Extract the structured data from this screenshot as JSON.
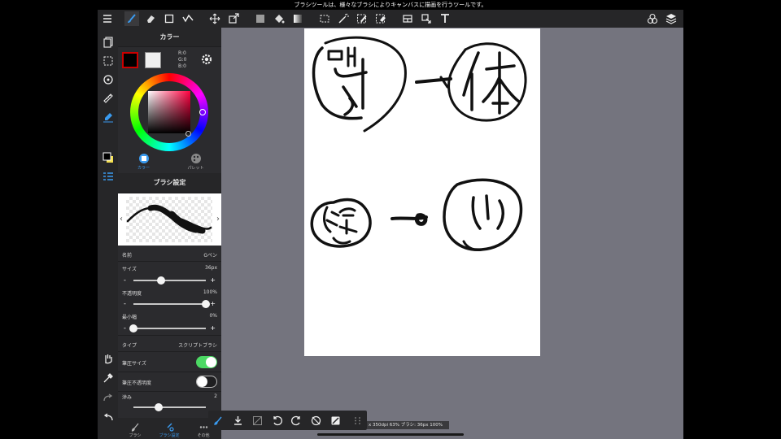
{
  "tooltip": "ブラシツールは、様々なブラシによりキャンバスに描画を行うツールです。",
  "toolbar": {
    "icons": [
      "menu-icon",
      "brush-icon",
      "eraser-icon",
      "shape-icon",
      "correction-pen-icon",
      "move-icon",
      "transform-icon",
      "fill-color-icon",
      "bucket-icon",
      "gradient-icon",
      "select-icon",
      "magic-wand-icon",
      "select-pen-icon",
      "select-eraser-icon",
      "panel-layout-icon",
      "select-layer-icon",
      "text-icon",
      "materials-icon",
      "layers-icon"
    ],
    "selected": "brush-icon"
  },
  "color_panel": {
    "title": "カラー",
    "r": "R:0",
    "g": "G:0",
    "b": "B:0",
    "tab_color": "カラー",
    "tab_palette": "パレット",
    "foreground": "#000000",
    "background": "#f0f0f0"
  },
  "brush_panel": {
    "title": "ブラシ設定",
    "name_label": "名前",
    "name_value": "Gペン",
    "size_label": "サイズ",
    "size_value": "36px",
    "size_level": 0.38,
    "opacity_label": "不透明度",
    "opacity_value": "100%",
    "opacity_level": 1.0,
    "min_width_label": "最小幅",
    "min_width_value": "0%",
    "min_width_level": 0.0,
    "type_label": "タイプ",
    "type_value": "スクリプトブラシ",
    "pressure_size_label": "筆圧サイズ",
    "pressure_size_on": true,
    "pressure_opacity_label": "筆圧不透明度",
    "pressure_opacity_on": false,
    "blur_label": "滲み",
    "blur_value": "2"
  },
  "bottom_tabs": {
    "brush": "ブラシ",
    "brush_settings": "ブラシ設定",
    "other": "その他"
  },
  "status": "x 350dpi 63% ブラシ: 36px 100%",
  "colors": {
    "accent": "#2f7ad6",
    "toggle_on": "#4cd964",
    "ui_dark": "#262628",
    "workspace": "#74747e"
  }
}
